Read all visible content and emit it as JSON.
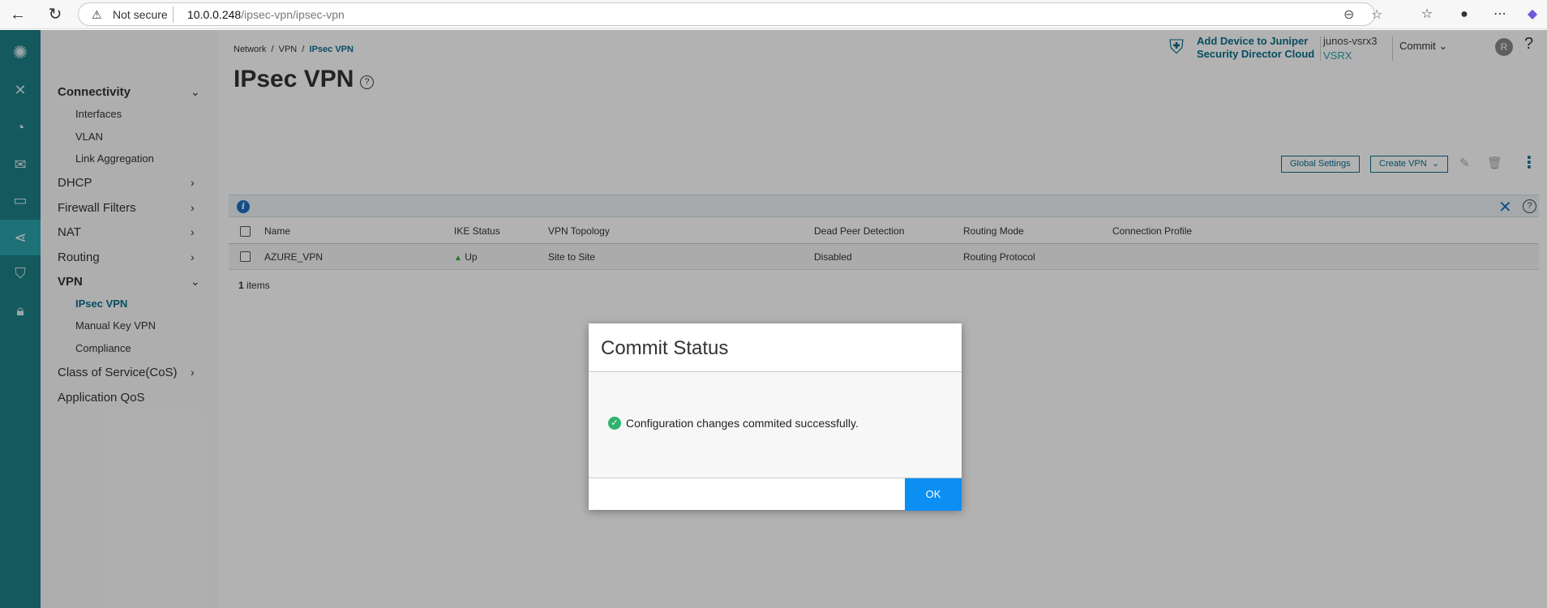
{
  "browser": {
    "security_label": "Not secure",
    "url_host": "10.0.0.248",
    "url_path": "/ipsec-vpn/ipsec-vpn"
  },
  "breadcrumb": {
    "items": [
      "Network",
      "VPN",
      "IPsec VPN"
    ]
  },
  "page": {
    "title": "IPsec VPN"
  },
  "header": {
    "sd_link_line1": "Add Device to Juniper",
    "sd_link_line2": "Security Director Cloud",
    "device_name": "junos-vsrx3",
    "device_model": "VSRX",
    "commit_label": "Commit",
    "avatar_letter": "R",
    "help": "?"
  },
  "sidebar": {
    "groups": [
      {
        "label": "Connectivity",
        "expanded": true,
        "items": [
          "Interfaces",
          "VLAN",
          "Link Aggregation"
        ]
      },
      {
        "label": "DHCP"
      },
      {
        "label": "Firewall Filters"
      },
      {
        "label": "NAT"
      },
      {
        "label": "Routing"
      },
      {
        "label": "VPN",
        "expanded": true,
        "items": [
          "IPsec VPN",
          "Manual Key VPN",
          "Compliance"
        ]
      },
      {
        "label": "Class of Service(CoS)"
      },
      {
        "label": "Application QoS"
      }
    ]
  },
  "toolbar": {
    "global_settings": "Global Settings",
    "create_vpn": "Create VPN"
  },
  "table": {
    "columns": [
      "Name",
      "IKE Status",
      "VPN Topology",
      "Dead Peer Detection",
      "Routing Mode",
      "Connection Profile"
    ],
    "rows": [
      {
        "name": "AZURE_VPN",
        "ike_status": "Up",
        "topology": "Site to Site",
        "dpd": "Disabled",
        "routing_mode": "Routing Protocol",
        "connection_profile": ""
      }
    ],
    "count": "1",
    "count_label": "items"
  },
  "modal": {
    "title": "Commit Status",
    "message": "Configuration changes commited successfully.",
    "ok": "OK"
  },
  "colors": {
    "accent": "#1c8087",
    "link": "#0b6f8c",
    "ok_button": "#0c8ff2",
    "success": "#2fb36c"
  }
}
